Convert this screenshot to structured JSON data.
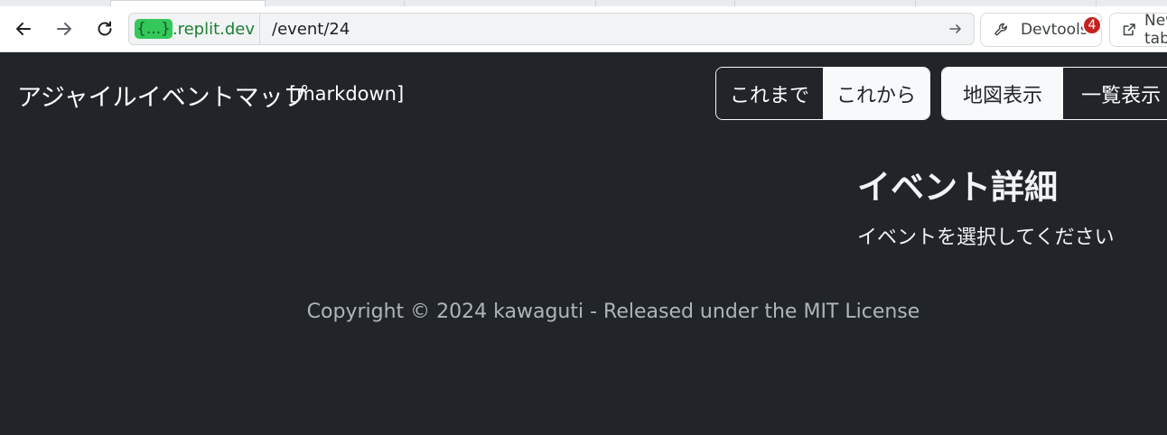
{
  "browser": {
    "url_host_badge": "{...}",
    "url_host": ".replit.dev",
    "url_path": "/event/24",
    "devtools_label": "Devtools",
    "devtools_badge_count": "4",
    "newtab_label": "New tab"
  },
  "header": {
    "brand": "アジャイルイベントマップ",
    "brand_sub": "[markdown]",
    "period_toggle": {
      "past": "これまで",
      "future": "これから",
      "selected": "これから"
    },
    "view_toggle": {
      "map": "地図表示",
      "list": "一覧表示",
      "selected": "地図表示"
    }
  },
  "detail": {
    "title": "イベント詳細",
    "message": "イベントを選択してください"
  },
  "footer": {
    "text": "Copyright © 2024 kawaguti - Released under the MIT License"
  },
  "colors": {
    "page_bg": "#212529",
    "light_button": "#f8f9fa",
    "footer_text": "#adb5bd",
    "notification": "#c5221f",
    "url_host": "#1e7e34"
  }
}
